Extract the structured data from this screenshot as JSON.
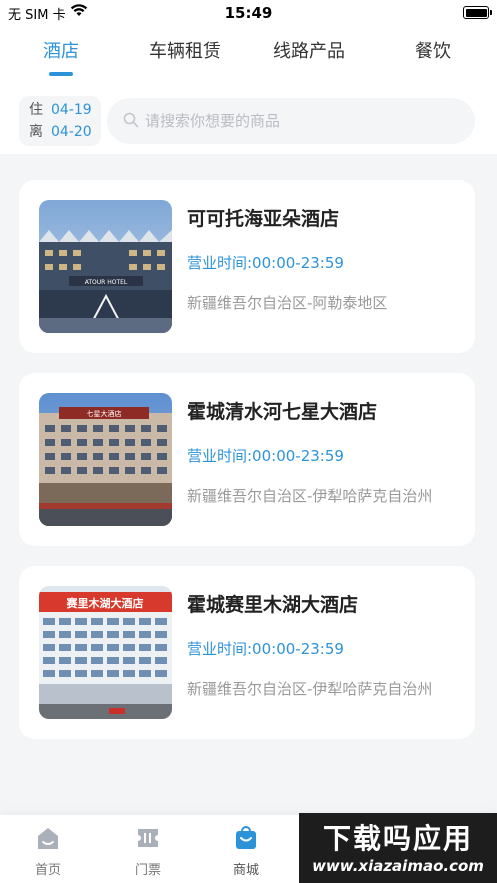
{
  "status_bar": {
    "carrier": "无 SIM 卡",
    "time": "15:49"
  },
  "tabs": [
    {
      "label": "酒店",
      "active": true
    },
    {
      "label": "车辆租赁",
      "active": false
    },
    {
      "label": "线路产品",
      "active": false
    },
    {
      "label": "餐饮",
      "active": false
    }
  ],
  "dates": {
    "checkin_label": "住",
    "checkin": "04-19",
    "checkout_label": "离",
    "checkout": "04-20"
  },
  "search": {
    "placeholder": "请搜索你想要的商品"
  },
  "hotels": [
    {
      "name": "可可托海亚朵酒店",
      "hours": "营业时间:00:00-23:59",
      "location": "新疆维吾尔自治区-阿勒泰地区",
      "photo_sign": "ATOUR HOTEL"
    },
    {
      "name": "霍城清水河七星大酒店",
      "hours": "营业时间:00:00-23:59",
      "location": "新疆维吾尔自治区-伊犁哈萨克自治州",
      "photo_sign": "七星大酒店"
    },
    {
      "name": "霍城赛里木湖大酒店",
      "hours": "营业时间:00:00-23:59",
      "location": "新疆维吾尔自治区-伊犁哈萨克自治州",
      "photo_sign": "赛里木湖大酒店"
    }
  ],
  "tabbar": [
    {
      "label": "首页",
      "icon": "home-icon"
    },
    {
      "label": "门票",
      "icon": "ticket-icon"
    },
    {
      "label": "商城",
      "icon": "shopping-bag-icon",
      "active": true
    }
  ],
  "watermark": {
    "line1": "下载吗应用",
    "line2": "www.xiazaimao.com"
  },
  "colors": {
    "accent": "#2d93d8",
    "background": "#f4f5f7",
    "card": "#ffffff",
    "muted_text": "#999999"
  }
}
